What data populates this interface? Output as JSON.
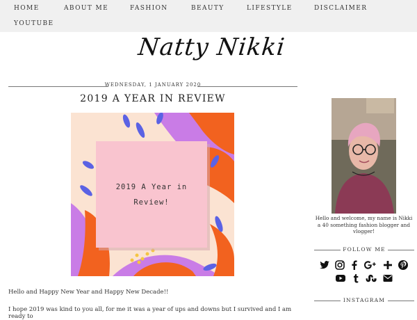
{
  "nav": {
    "items": [
      "HOME",
      "ABOUT ME",
      "FASHION",
      "BEAUTY",
      "LIFESTYLE",
      "DISCLAIMER",
      "YOUTUBE"
    ]
  },
  "brand": {
    "title": "Natty Nikki"
  },
  "post": {
    "date": "WEDNESDAY, 1 JANUARY 2020",
    "title": "2019 A YEAR IN REVIEW",
    "image_caption": [
      "2019 A Year in",
      "Review!"
    ],
    "paragraphs": [
      "Hello and Happy New Year and Happy New Decade!!",
      "I hope 2019 was kind to you all, for me it was a year of ups and downs but I survived and I am ready to"
    ]
  },
  "sidebar": {
    "about_text": "Hello and welcome, my name is Nikki a 40 something fashion blogger and vlogger!",
    "follow_title": "FOLLOW ME",
    "instagram_title": "INSTAGRAM",
    "social_icons": [
      "twitter-icon",
      "instagram-icon",
      "facebook-icon",
      "google-plus-icon",
      "bloglovin-icon",
      "pinterest-icon",
      "youtube-icon",
      "tumblr-icon",
      "stumbleupon-icon",
      "email-icon"
    ]
  },
  "colors": {
    "nav_bg": "#f0f0f0",
    "hero_orange": "#f2621f",
    "hero_purple": "#c97ce6",
    "hero_blue": "#5b62e4",
    "hero_pink_card": "#f9c4cf",
    "hero_peach": "#fbe3d2"
  }
}
